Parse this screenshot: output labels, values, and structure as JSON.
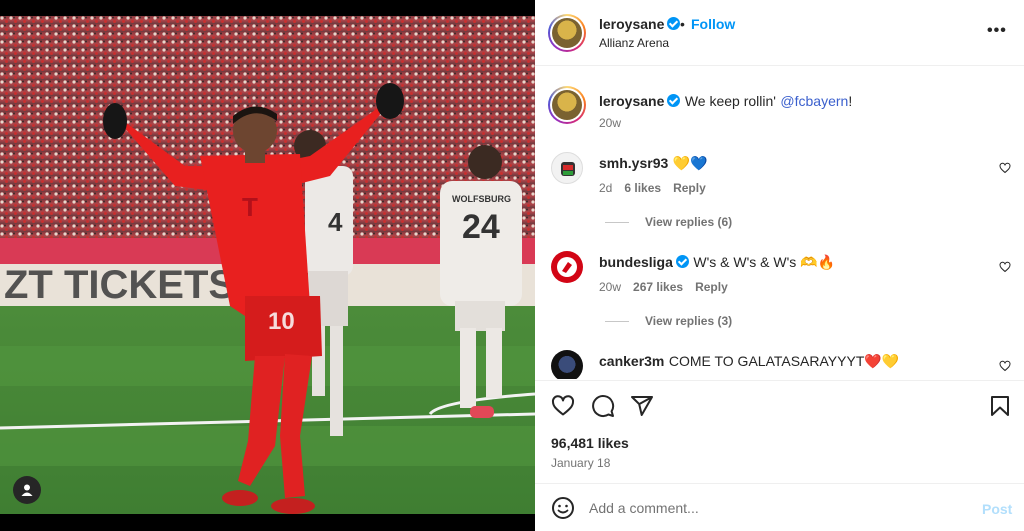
{
  "post": {
    "username": "leroysane",
    "follow_label": "Follow",
    "separator": "•",
    "location": "Allianz Arena",
    "more_label": "•••",
    "caption_text": "We keep rollin'",
    "caption_mention": "@fcbayern",
    "caption_end": "!",
    "caption_time": "20w"
  },
  "photo": {
    "board_text": "ZT TICKETS SIC",
    "jersey_main": "10",
    "jersey_back_1": "4",
    "jersey_back_2": "24",
    "sponsor_back": "WOLFSBURG"
  },
  "comments": [
    {
      "username": "smh.ysr93",
      "text": "💛💙",
      "time": "2d",
      "likes": "6 likes",
      "reply": "Reply",
      "view_replies": "View replies (6)"
    },
    {
      "username": "bundesliga",
      "text": "W's & W's & W's 🫶🔥",
      "time": "20w",
      "likes": "267 likes",
      "reply": "Reply",
      "view_replies": "View replies (3)"
    },
    {
      "username": "canker3m",
      "text": "COME TO GALATASARAYYYT❤️💛"
    }
  ],
  "stats": {
    "likes": "96,481 likes",
    "date": "January 18"
  },
  "composer": {
    "placeholder": "Add a comment...",
    "post_label": "Post"
  },
  "colors": {
    "accent": "#0095f6",
    "post_disabled": "#b2dffc",
    "jersey_red": "#e8201f"
  }
}
